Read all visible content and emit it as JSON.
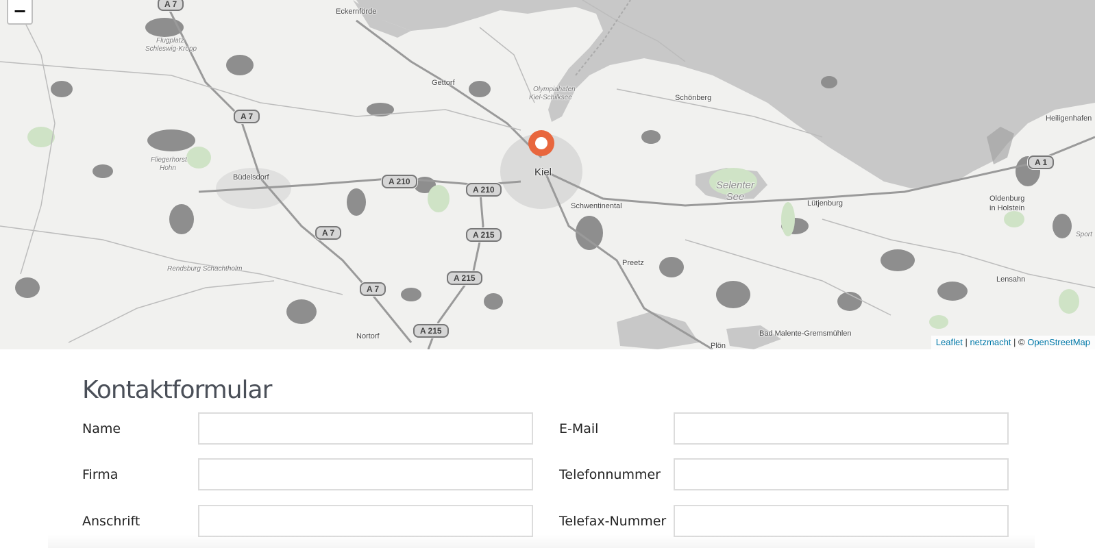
{
  "map": {
    "zoom_out_label": "−",
    "marker_icon": "location-marker-icon",
    "marker_color": "#e8663d",
    "water_color": "#c8c8c8",
    "places": {
      "eckernfoerde": "Eckernförde",
      "gettorf": "Gettorf",
      "schoenberg": "Schönberg",
      "heiligenhafen": "Heiligenhafen",
      "kiel": "Kiel",
      "buedelsdorf": "Büdelsdorf",
      "schwentinental": "Schwentinental",
      "luetjenburg": "Lütjenburg",
      "oldenburg": "Oldenburg",
      "oldenburg2": "in Holstein",
      "preetz": "Preetz",
      "lensahn": "Lensahn",
      "nortorf": "Nortorf",
      "bad_malente": "Bad Malente-Gremsmühlen",
      "ploen": "Plön",
      "selenter_see_1": "Selenter",
      "selenter_see_2": "See",
      "flugplatz": "Flugplatz",
      "flugplatz2": "Schleswig-Kropp",
      "fliegerhorst": "Fliegerhorst",
      "fliegerhorst2": "Hohn",
      "rendsburg": "Rendsburg Schachtholm",
      "olympiahafen": "Olympiahafen",
      "olympiahafen2": "Kiel-Schilksee",
      "sport": "Sport"
    },
    "roads": {
      "a7_top": "A 7",
      "a7_mid": "A 7",
      "a7_low": "A 7",
      "a7_bottom": "A 7",
      "a210_left": "A 210",
      "a210_right": "A 210",
      "a215_top": "A 215",
      "a215_mid": "A 215",
      "a215_bottom": "A 215",
      "a1": "A 1"
    },
    "attribution": {
      "leaflet": "Leaflet",
      "sep1": " | ",
      "netzmacht": "netzmacht",
      "sep2": " | © ",
      "osm": "OpenStreetMap"
    }
  },
  "form": {
    "title": "Kontaktformular",
    "fields": {
      "name_label": "Name",
      "name_value": "",
      "email_label": "E-Mail",
      "email_value": "",
      "company_label": "Firma",
      "company_value": "",
      "phone_label": "Telefonnummer",
      "phone_value": "",
      "address_label": "Anschrift",
      "address_value": "",
      "fax_label": "Telefax-Nummer",
      "fax_value": ""
    }
  }
}
